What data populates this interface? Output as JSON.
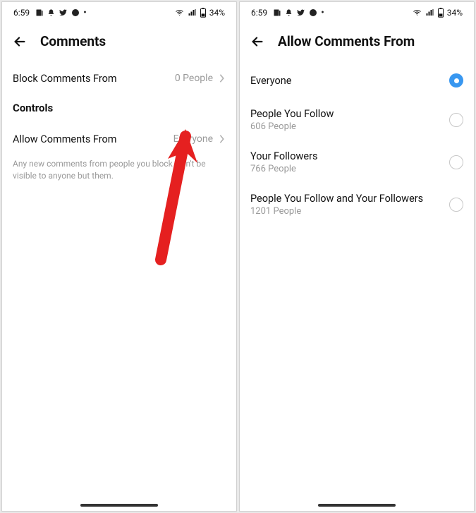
{
  "status": {
    "time": "6:59",
    "battery_text": "34%"
  },
  "left": {
    "title": "Comments",
    "block_row": {
      "label": "Block Comments From",
      "value": "0 People"
    },
    "controls_heading": "Controls",
    "allow_row": {
      "label": "Allow Comments From",
      "value": "Everyone"
    },
    "helper": "Any new comments from people you block won't be visible to anyone but them."
  },
  "right": {
    "title": "Allow Comments From",
    "options": [
      {
        "label": "Everyone",
        "sub": "",
        "selected": true
      },
      {
        "label": "People You Follow",
        "sub": "606 People",
        "selected": false
      },
      {
        "label": "Your Followers",
        "sub": "766 People",
        "selected": false
      },
      {
        "label": "People You Follow and Your Followers",
        "sub": "1201 People",
        "selected": false
      }
    ]
  }
}
